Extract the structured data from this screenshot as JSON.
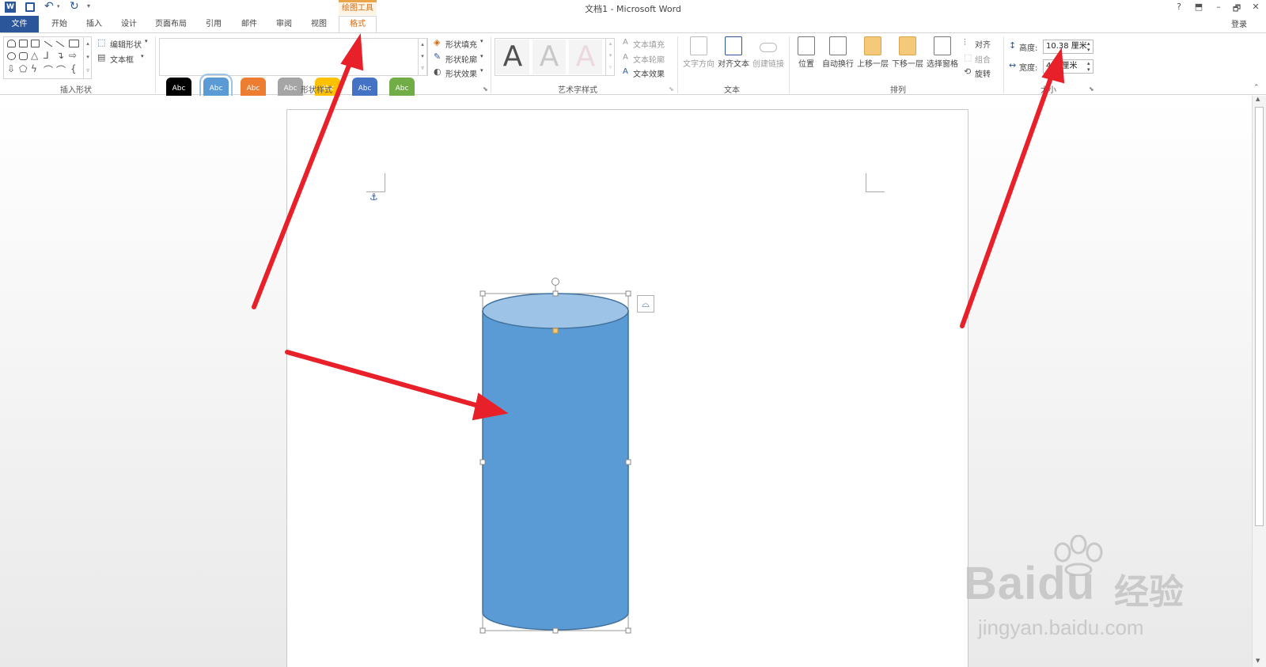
{
  "titlebar": {
    "doc_title": "文档1 - Microsoft Word",
    "context_tool": "绘图工具",
    "help": "?",
    "minimize": "–",
    "restore": "🗗",
    "close": "✕",
    "signin": "登录"
  },
  "tabs": {
    "file": "文件",
    "home": "开始",
    "insert": "插入",
    "design": "设计",
    "layout": "页面布局",
    "references": "引用",
    "mailings": "邮件",
    "review": "审阅",
    "view": "视图",
    "format": "格式"
  },
  "groups": {
    "insert_shapes": "插入形状",
    "shape_styles": "形状样式",
    "wordart_styles": "艺术字样式",
    "text": "文本",
    "arrange": "排列",
    "size": "大小"
  },
  "commands": {
    "edit_shape": "编辑形状",
    "text_box": "文本框",
    "shape_fill": "形状填充",
    "shape_outline": "形状轮廓",
    "shape_effects": "形状效果",
    "text_fill": "文本填充",
    "text_outline": "文本轮廓",
    "text_effects": "文本效果",
    "text_direction": "文字方向",
    "align_text": "对齐文本",
    "create_link": "创建链接",
    "position": "位置",
    "wrap_text": "自动换行",
    "bring_forward": "上移一层",
    "send_backward": "下移一层",
    "selection_pane": "选择窗格",
    "align": "对齐",
    "group": "组合",
    "rotate": "旋转"
  },
  "styles": [
    {
      "label": "Abc",
      "color": "#000000"
    },
    {
      "label": "Abc",
      "color": "#5b9bd5"
    },
    {
      "label": "Abc",
      "color": "#ed7d31"
    },
    {
      "label": "Abc",
      "color": "#a5a5a5"
    },
    {
      "label": "Abc",
      "color": "#ffc000"
    },
    {
      "label": "Abc",
      "color": "#4472c4"
    },
    {
      "label": "Abc",
      "color": "#70ad47"
    }
  ],
  "size": {
    "height_label": "高度:",
    "height_value": "10.38 厘米",
    "width_label": "宽度:",
    "width_value": "4.…厘米"
  },
  "wordart": {
    "letter": "A"
  },
  "watermark": {
    "brand": "Bai",
    "brand2": "du",
    "cn": "经验",
    "url": "jingyan.baidu.com"
  },
  "colors": {
    "accent": "#2b579a",
    "shape_fill": "#5b9bd5",
    "shape_top": "#9dc3e6",
    "arrow": "#e8202a",
    "context": "#d46a10"
  }
}
